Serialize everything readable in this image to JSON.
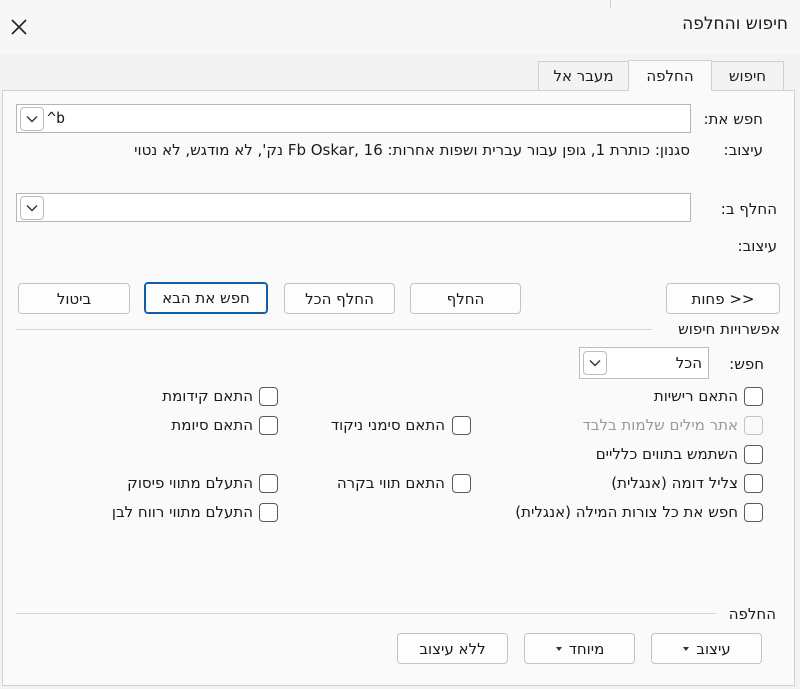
{
  "window": {
    "title": "חיפוש והחלפה",
    "close_icon": "close-icon"
  },
  "tabs": [
    {
      "label": "חיפוש",
      "active": false
    },
    {
      "label": "החלפה",
      "active": true
    },
    {
      "label": "מעבר אל",
      "active": false
    }
  ],
  "find": {
    "label": "חפש את:",
    "value": "^b",
    "format_label": "עיצוב:",
    "format_value": "סגנון: כותרת 1, גופן עבור עברית ושפות אחרות: Fb Oskar, 16 נק', לא מודגש, לא נטוי"
  },
  "replace": {
    "label": "החלף ב:",
    "value": "",
    "format_label": "עיצוב:"
  },
  "buttons": {
    "less": "<< פחות",
    "replace": "החלף",
    "replace_all": "החלף הכל",
    "find_next": "חפש את הבא",
    "cancel": "ביטול"
  },
  "options": {
    "section_title": "אפשרויות חיפוש",
    "search_label": "חפש:",
    "search_value": "הכל",
    "checkboxes": {
      "match_case": "התאם רישיות",
      "whole_words": "אתר מילים שלמות בלבד",
      "wildcards": "השתמש בתווים כלליים",
      "sounds_like": "צליל דומה (אנגלית)",
      "all_word_forms": "חפש את כל צורות המילה (אנגלית)",
      "match_prefix": "התאם קידומת",
      "match_suffix": "התאם סיומת",
      "match_diacritics": "התאם סימני ניקוד",
      "match_kashida": "התאם תווי בקרה",
      "ignore_punct": "התעלם מתווי פיסוק",
      "ignore_space": "התעלם מתווי רווח לבן"
    }
  },
  "replace_section": {
    "title": "החלפה",
    "format_button": "עיצוב",
    "special_button": "מיוחד",
    "no_format_button": "ללא עיצוב"
  },
  "colors": {
    "accent": "#0f5ea8",
    "background": "#f3f3f3",
    "panel": "#fafafa"
  }
}
